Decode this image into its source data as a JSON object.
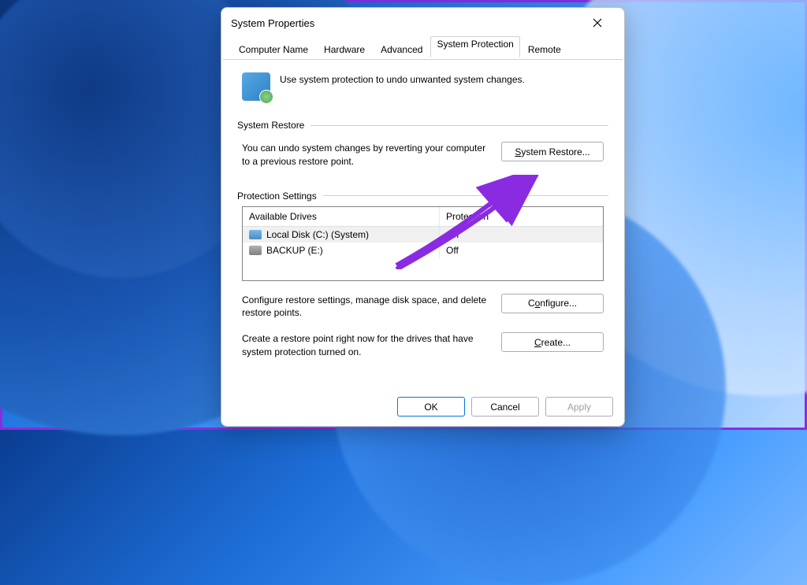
{
  "window": {
    "title": "System Properties"
  },
  "tabs": [
    {
      "label": "Computer Name"
    },
    {
      "label": "Hardware"
    },
    {
      "label": "Advanced"
    },
    {
      "label": "System Protection",
      "active": true
    },
    {
      "label": "Remote"
    }
  ],
  "intro": "Use system protection to undo unwanted system changes.",
  "groups": {
    "restore": {
      "title": "System Restore",
      "text": "You can undo system changes by reverting your computer to a previous restore point.",
      "button": "System Restore..."
    },
    "protection": {
      "title": "Protection Settings",
      "columns": {
        "drives": "Available Drives",
        "protection": "Protection"
      },
      "rows": [
        {
          "name": "Local Disk (C:) (System)",
          "protection": "On",
          "icon": "blue",
          "selected": true
        },
        {
          "name": "BACKUP (E:)",
          "protection": "Off",
          "icon": "grey",
          "selected": false
        }
      ],
      "configure": {
        "text": "Configure restore settings, manage disk space, and delete restore points.",
        "button": "Configure..."
      },
      "create": {
        "text": "Create a restore point right now for the drives that have system protection turned on.",
        "button": "Create..."
      }
    }
  },
  "buttons": {
    "ok": "OK",
    "cancel": "Cancel",
    "apply": "Apply"
  },
  "annotation": {
    "highlight_tab": "System Protection",
    "arrow_target": "System Restore...",
    "arrow_color": "#8a2be2"
  }
}
